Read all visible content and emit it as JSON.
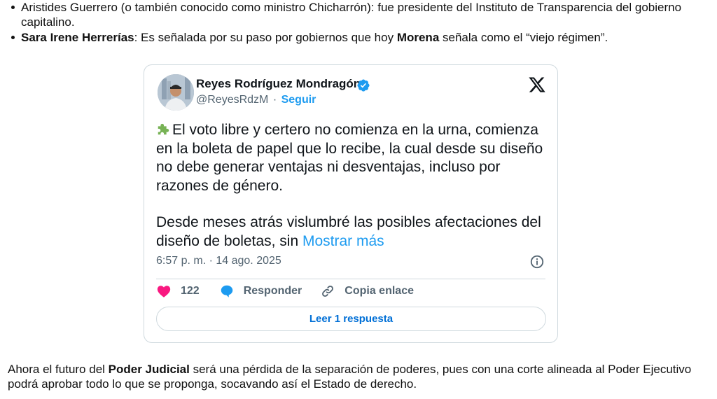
{
  "bullets": {
    "item1": {
      "text": "Aristides Guerrero (o también conocido como ministro Chicharrón): fue presidente del Instituto de Transparencia del gobierno capitalino."
    },
    "item2": {
      "name": "Sara Irene Herrerías",
      "text_before": ": Es señalada por su paso por gobiernos que hoy ",
      "party": "Morena",
      "text_after": " señala como el “viejo régimen”."
    }
  },
  "tweet": {
    "author_name": "Reyes Rodríguez Mondragón",
    "handle": "@ReyesRdzM",
    "separator": "·",
    "follow_label": "Seguir",
    "paragraph1": "El voto libre y certero no comienza en la urna, comienza en la boleta de papel que lo recibe, la cual desde su diseño no debe generar ventajas ni desventajas, incluso por razones de género.",
    "paragraph2": "Desde meses atrás vislumbré las posibles afectaciones del diseño de boletas, sin ",
    "show_more": "Mostrar más",
    "timestamp": "6:57 p. m. · 14 ago. 2025",
    "likes": "122",
    "reply_label": "Responder",
    "copy_link_label": "Copia enlace",
    "read_reply_label": "Leer 1 respuesta",
    "colors": {
      "link": "#1d9bf0",
      "heart": "#f91880",
      "reply_icon": "#1d9bf0",
      "muted": "#536471"
    },
    "icons": [
      "verified-badge-icon",
      "x-logo-icon",
      "puzzle-piece-emoji",
      "info-icon",
      "heart-icon",
      "reply-bubble-icon",
      "link-icon"
    ]
  },
  "paragraph": {
    "part1": "Ahora el futuro del ",
    "bold": "Poder Judicial",
    "part2": " será una pérdida de la separación de poderes, pues con una corte alineada al Poder Ejecutivo podrá aprobar todo lo que se proponga, socavando así el Estado de derecho."
  }
}
